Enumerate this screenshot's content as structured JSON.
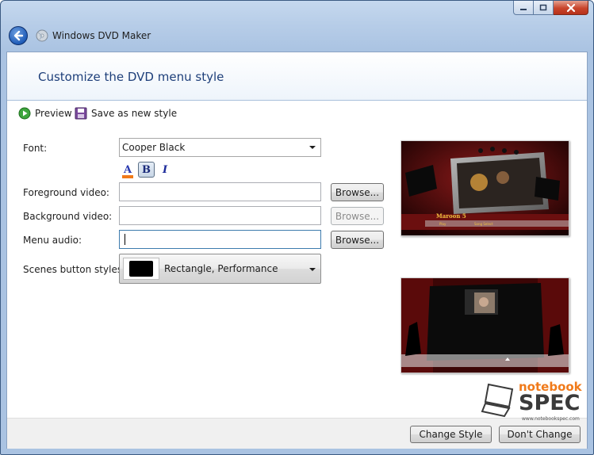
{
  "window": {
    "title": "Windows DVD Maker",
    "caption_buttons": [
      "minimize",
      "maximize",
      "close"
    ]
  },
  "header": {
    "title": "Customize the DVD menu style"
  },
  "toolbar": {
    "preview_label": "Preview",
    "save_style_label": "Save as new style"
  },
  "form": {
    "font_label": "Font:",
    "font_value": "Cooper Black",
    "font_color_glyph": "A",
    "bold_glyph": "B",
    "italic_glyph": "I",
    "font_color_accent": "#f07a1a",
    "foreground_label": "Foreground video:",
    "foreground_value": "",
    "background_label": "Background video:",
    "background_value": "",
    "audio_label": "Menu audio:",
    "audio_value": "",
    "browse_label": "Browse...",
    "scenes_label": "Scenes button styles:",
    "scenes_value": "Rectangle, Performance"
  },
  "previews": {
    "menu": {
      "title": "Maroon 5",
      "play": "Play",
      "scenes": "Song Select"
    },
    "scenes": {}
  },
  "footer": {
    "change_label": "Change Style",
    "dont_change_label": "Don't Change"
  },
  "watermark": {
    "line1": "notebook",
    "line2": "SPEC",
    "line3": "www.notebookspec.com"
  }
}
